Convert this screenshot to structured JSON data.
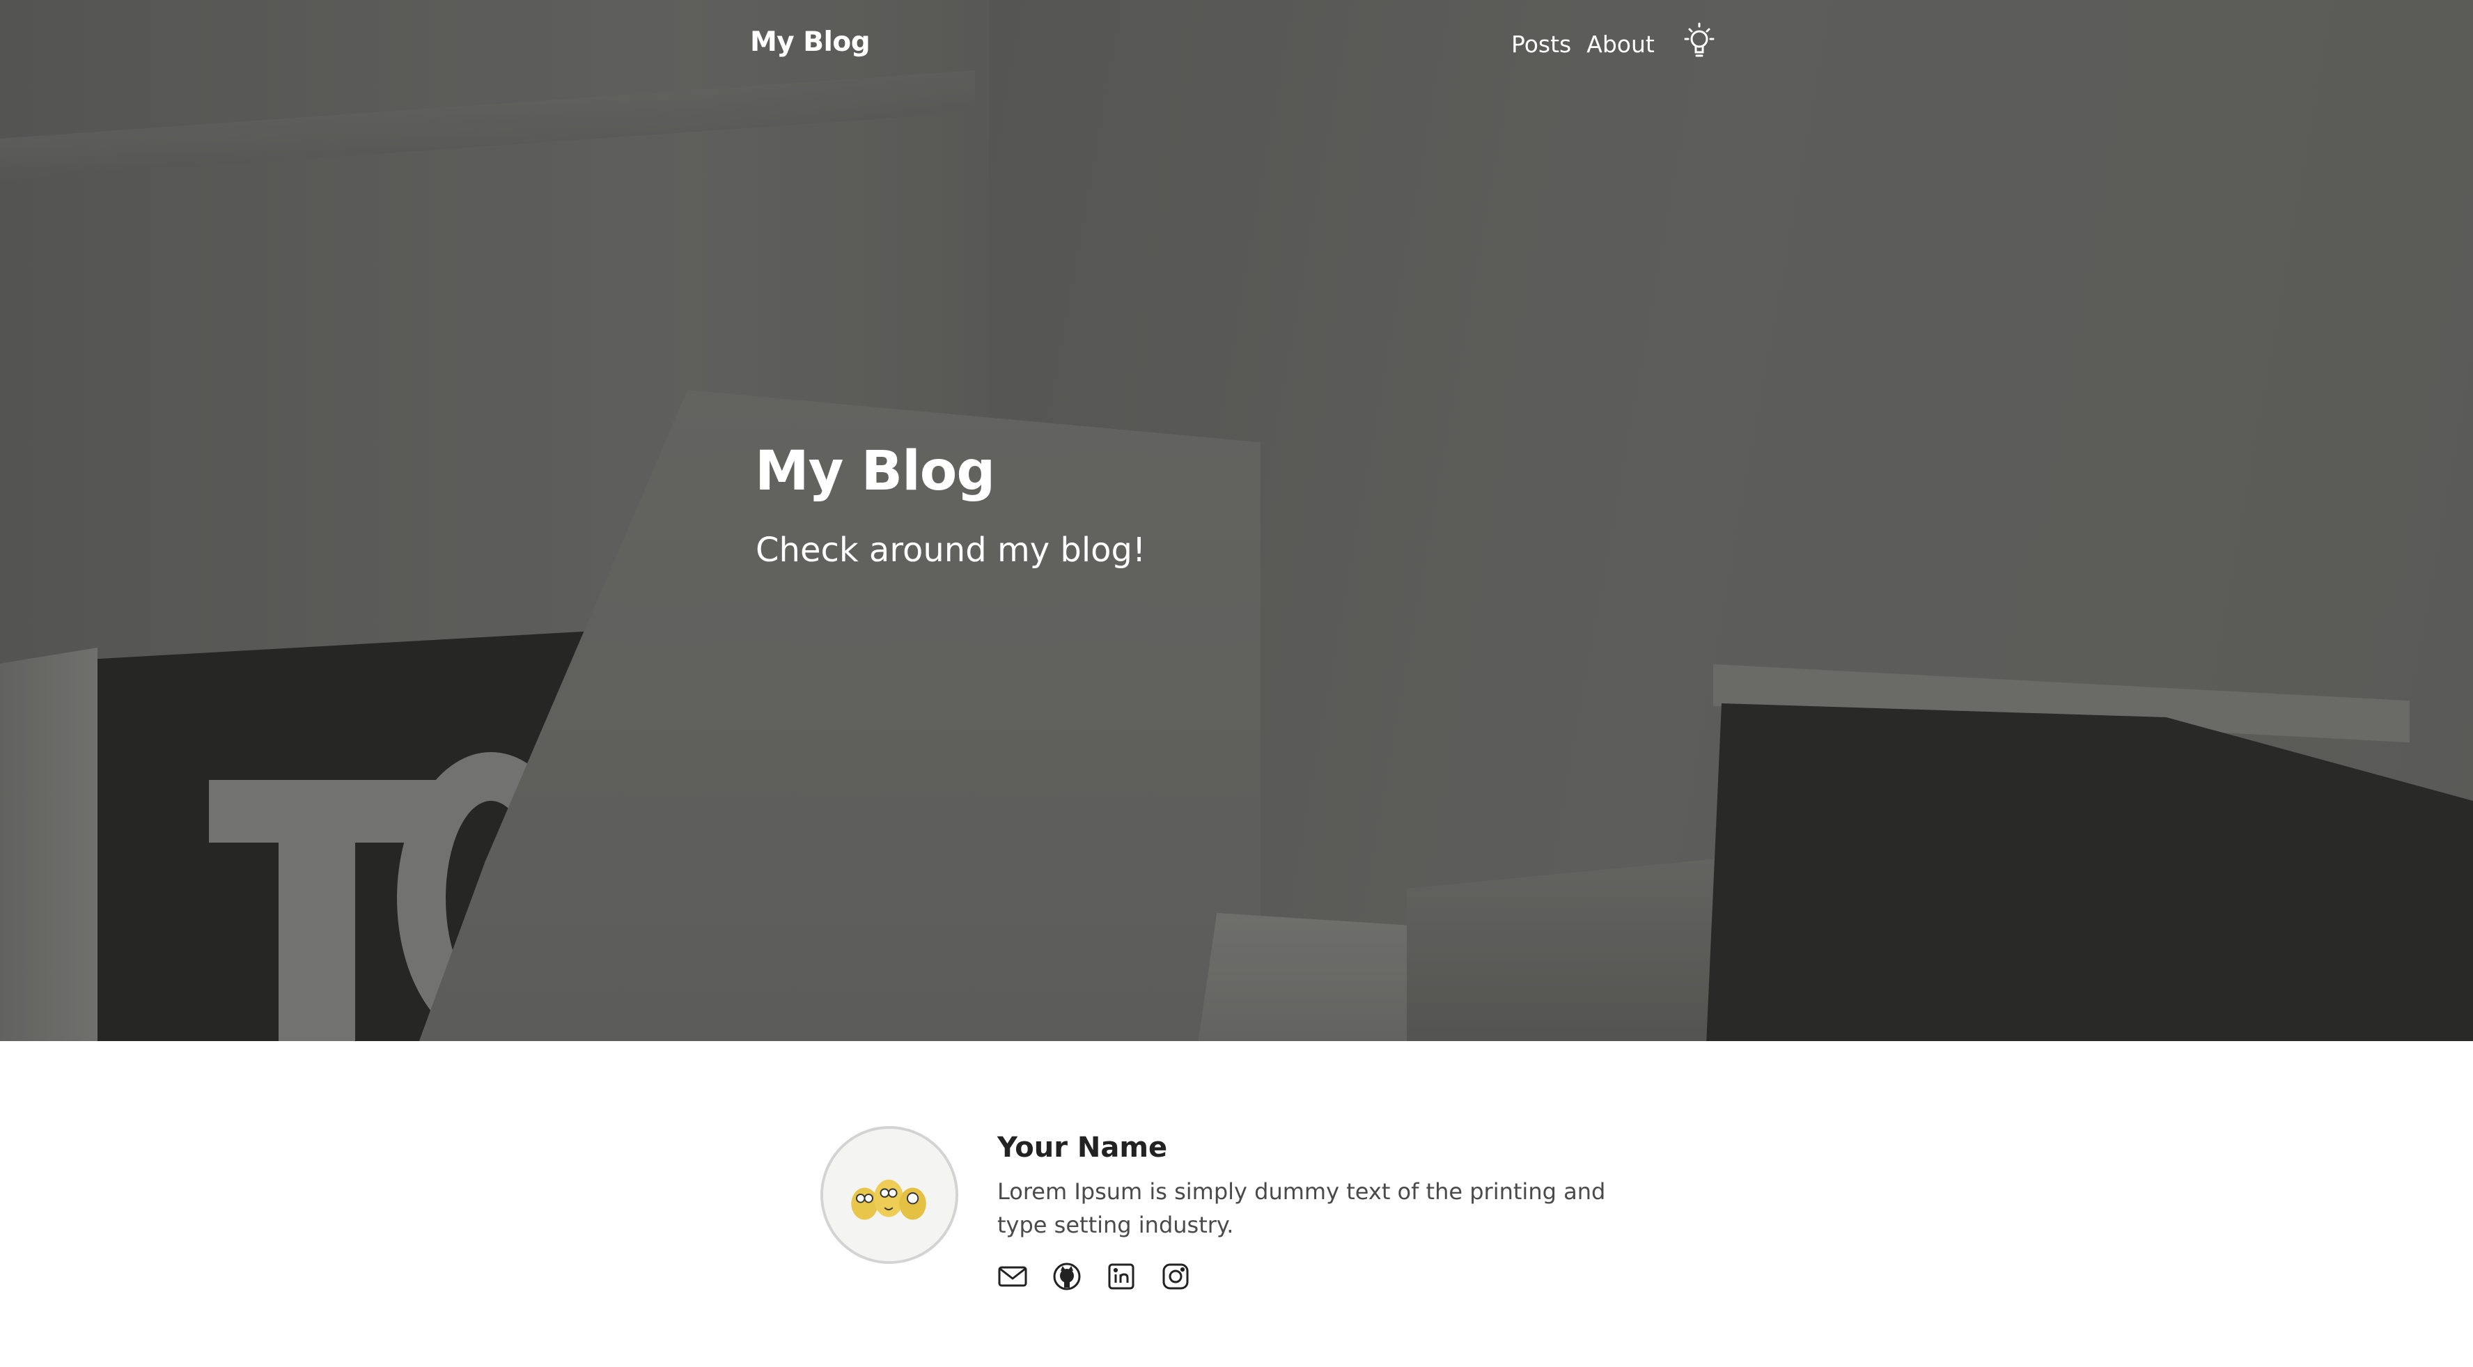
{
  "nav": {
    "brand": "My Blog",
    "links": [
      {
        "label": "Posts"
      },
      {
        "label": "About"
      }
    ],
    "theme_toggle_icon": "lightbulb-icon"
  },
  "hero": {
    "title": "My Blog",
    "subtitle": "Check around my blog!"
  },
  "profile": {
    "name": "Your Name",
    "bio": "Lorem Ipsum is simply dummy text of the printing and type setting industry.",
    "avatar_icon": "avatar-image",
    "social": [
      {
        "icon": "email-icon"
      },
      {
        "icon": "github-icon"
      },
      {
        "icon": "linkedin-icon"
      },
      {
        "icon": "instagram-icon"
      }
    ]
  },
  "colors": {
    "text_on_hero": "#ffffff",
    "name": "#222222",
    "bio": "#4a4a4a",
    "footer_edge": "#2e3440"
  }
}
